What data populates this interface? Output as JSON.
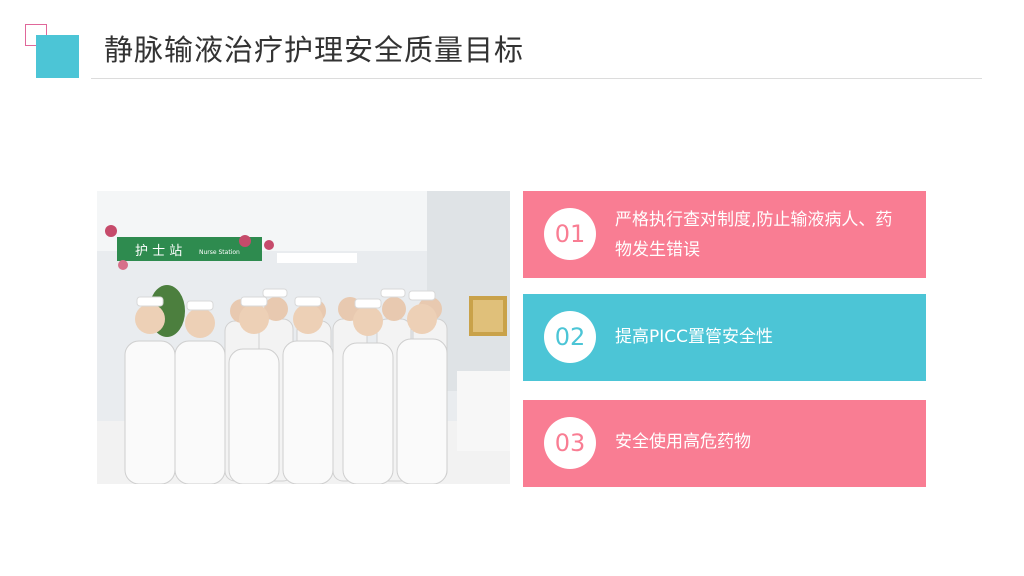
{
  "title": "静脉输液治疗护理安全质量目标",
  "photo": {
    "sign_text": "护 士 站",
    "sign_subtext": "Nurse Station"
  },
  "items": [
    {
      "number": "01",
      "text": "严格执行查对制度,防止输液病人、药物发生错误",
      "color": "#f97d93"
    },
    {
      "number": "02",
      "text": "提高PICC置管安全性",
      "color": "#4cc5d6"
    },
    {
      "number": "03",
      "text": "安全使用高危药物",
      "color": "#f97d93"
    }
  ],
  "colors": {
    "accent_pink": "#f97d93",
    "accent_teal": "#4cc5d6",
    "title_text": "#333333"
  }
}
